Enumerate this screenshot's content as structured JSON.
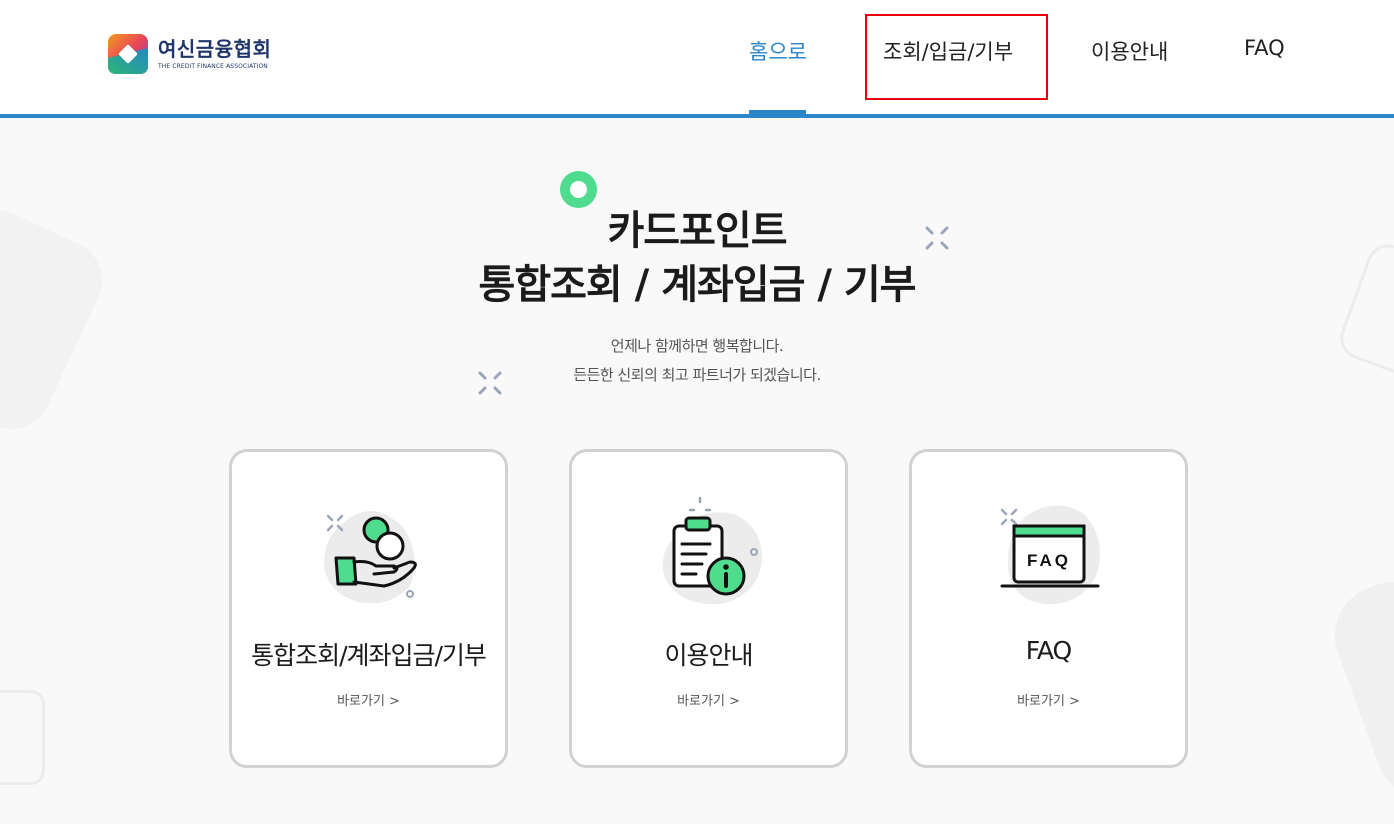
{
  "header": {
    "logo": {
      "name_ko": "여신금융협회",
      "name_en": "THE CREDIT FINANCE ASSOCIATION"
    },
    "nav": [
      {
        "label": "홈으로",
        "active": true
      },
      {
        "label": "조회/입금/기부",
        "active": false
      },
      {
        "label": "이용안내",
        "active": false
      },
      {
        "label": "FAQ",
        "active": false
      }
    ]
  },
  "hero": {
    "title_line1": "카드포인트",
    "title_line2": "통합조회 / 계좌입금 / 기부",
    "desc_line1": "언제나 함께하면 행복합니다.",
    "desc_line2": "든든한 신뢰의 최고 파트너가 되겠습니다."
  },
  "cards": [
    {
      "title": "통합조회/계좌입금/기부",
      "link": "바로가기 >",
      "icon": "coin-hand-icon"
    },
    {
      "title": "이용안내",
      "link": "바로가기 >",
      "icon": "clipboard-info-icon"
    },
    {
      "title": "FAQ",
      "link": "바로가기 >",
      "icon": "faq-screen-icon"
    }
  ],
  "colors": {
    "accent": "#2a86c8",
    "brand_navy": "#20366b",
    "icon_green": "#4fdc8f",
    "highlight_red": "#e8000b"
  }
}
